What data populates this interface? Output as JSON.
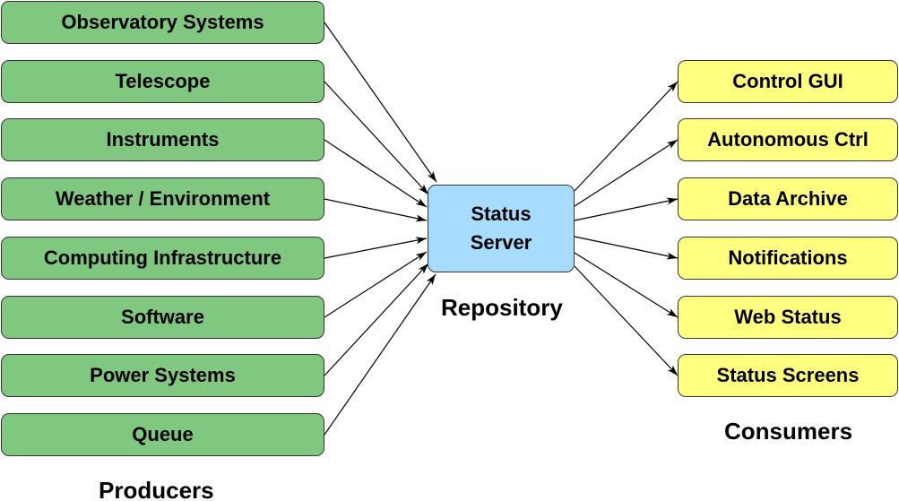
{
  "producers": {
    "title": "Producers",
    "items": [
      "Observatory Systems",
      "Telescope",
      "Instruments",
      "Weather / Environment",
      "Computing Infrastructure",
      "Software",
      "Power Systems",
      "Queue"
    ],
    "color": "#80c880"
  },
  "repository": {
    "title": "Repository",
    "server_label": "Status\nServer",
    "color": "#a8dcff"
  },
  "consumers": {
    "title": "Consumers",
    "items": [
      "Control GUI",
      "Autonomous Ctrl",
      "Data Archive",
      "Notifications",
      "Web Status",
      "Status Screens"
    ],
    "color": "#ffff80"
  }
}
